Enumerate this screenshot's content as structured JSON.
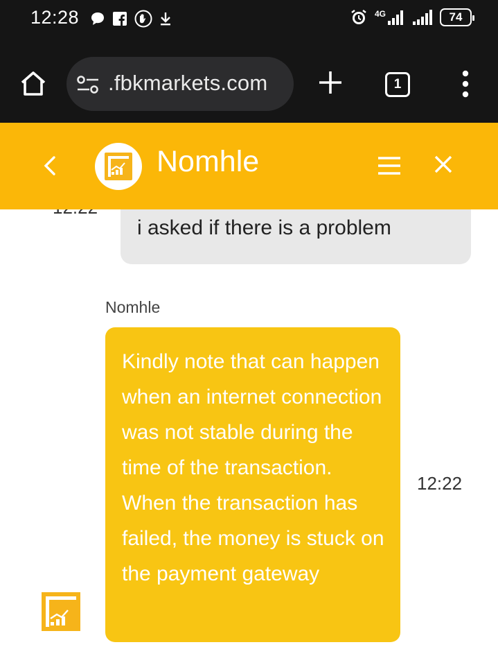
{
  "status_bar": {
    "time": "12:28",
    "network": "4G",
    "battery": "74"
  },
  "browser": {
    "url": ".fbkmarkets.com",
    "tab_count": "1"
  },
  "chat": {
    "agent_name": "Nomhle",
    "messages": [
      {
        "from": "user",
        "time": "12:22",
        "text": "i asked if there is a problem"
      },
      {
        "from": "agent",
        "sender": "Nomhle",
        "time": "12:22",
        "text": "Kindly note that can happen when an internet connection was not stable during the time of the transaction. When the transaction has failed, the money is stuck on the payment gateway"
      }
    ]
  },
  "colors": {
    "header_bg": "#fbb708",
    "agent_bubble": "#f8c513",
    "user_bubble": "#e8e8e8",
    "browser_bg": "#151515"
  },
  "icons": [
    "chat-icon",
    "facebook-icon",
    "hand-icon",
    "download-icon",
    "alarm-icon",
    "signal-icon",
    "home-icon",
    "tune-icon",
    "plus-icon",
    "more-vert-icon",
    "chevron-left-icon",
    "menu-icon",
    "close-icon",
    "logo-icon"
  ]
}
